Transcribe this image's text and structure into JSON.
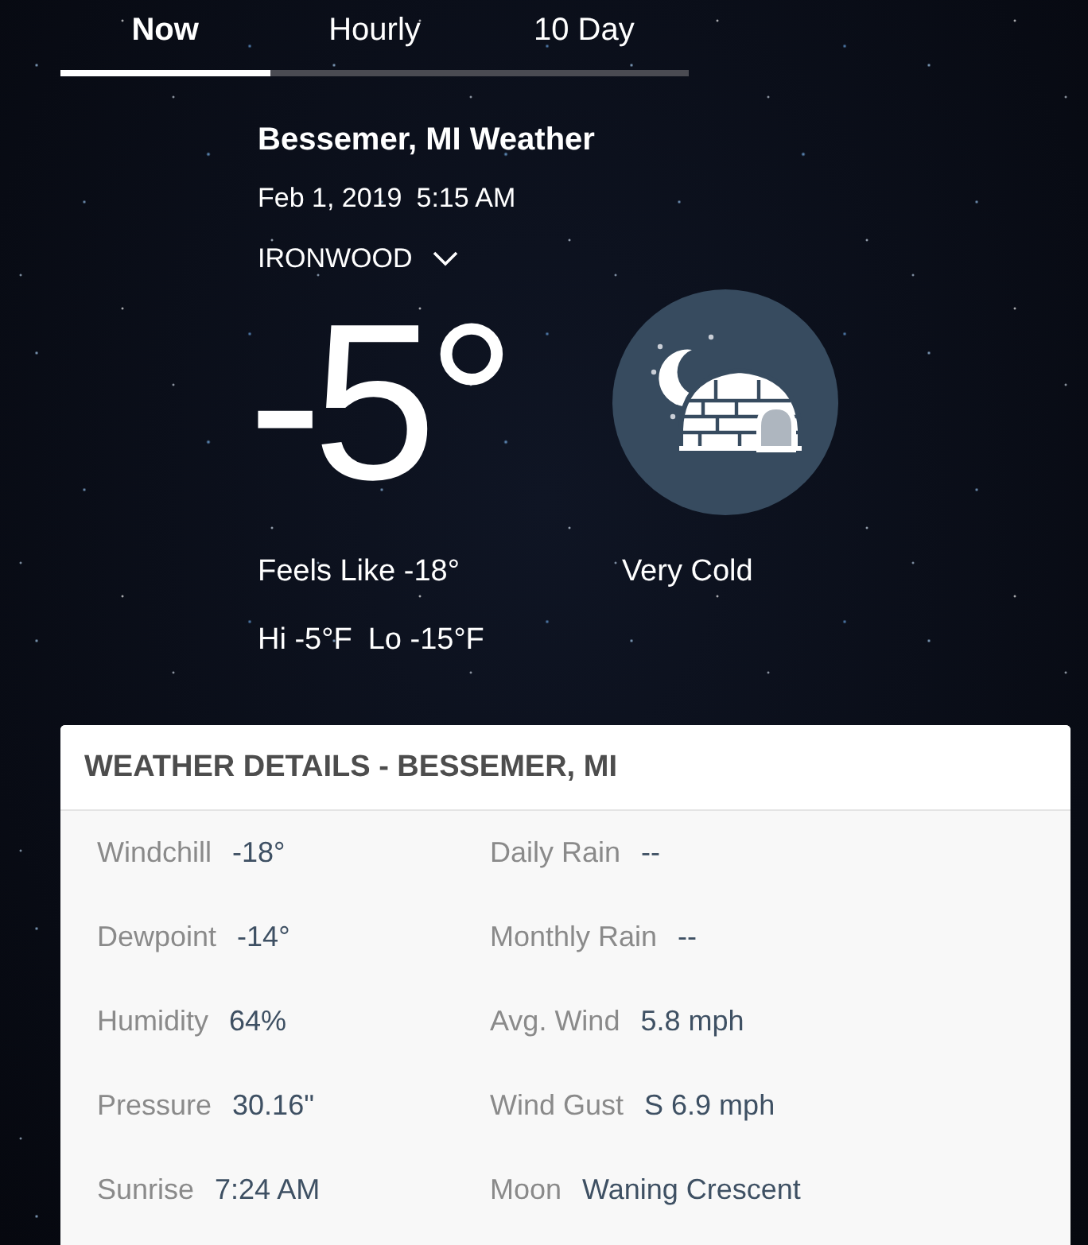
{
  "tabs": [
    {
      "label": "Now",
      "selected": true
    },
    {
      "label": "Hourly",
      "selected": false
    },
    {
      "label": "10 Day",
      "selected": false
    }
  ],
  "location": {
    "title": "Bessemer, MI Weather",
    "date": "Feb 1, 2019",
    "time": "5:15 AM",
    "station": "IRONWOOD"
  },
  "current": {
    "temperature": "-5°",
    "feels_like": "Feels Like -18°",
    "condition": "Very Cold",
    "hi": "Hi -5°F",
    "lo": "Lo -15°F"
  },
  "details": {
    "title": "WEATHER DETAILS - BESSEMER, MI",
    "items": [
      {
        "label": "Windchill",
        "value": "-18°"
      },
      {
        "label": "Daily Rain",
        "value": "--"
      },
      {
        "label": "Dewpoint",
        "value": "-14°"
      },
      {
        "label": "Monthly Rain",
        "value": "--"
      },
      {
        "label": "Humidity",
        "value": "64%"
      },
      {
        "label": "Avg. Wind",
        "value": "5.8 mph"
      },
      {
        "label": "Pressure",
        "value": "30.16\""
      },
      {
        "label": "Wind Gust",
        "value": "S 6.9 mph"
      },
      {
        "label": "Sunrise",
        "value": "7:24 AM"
      },
      {
        "label": "Moon",
        "value": "Waning Crescent"
      }
    ]
  }
}
